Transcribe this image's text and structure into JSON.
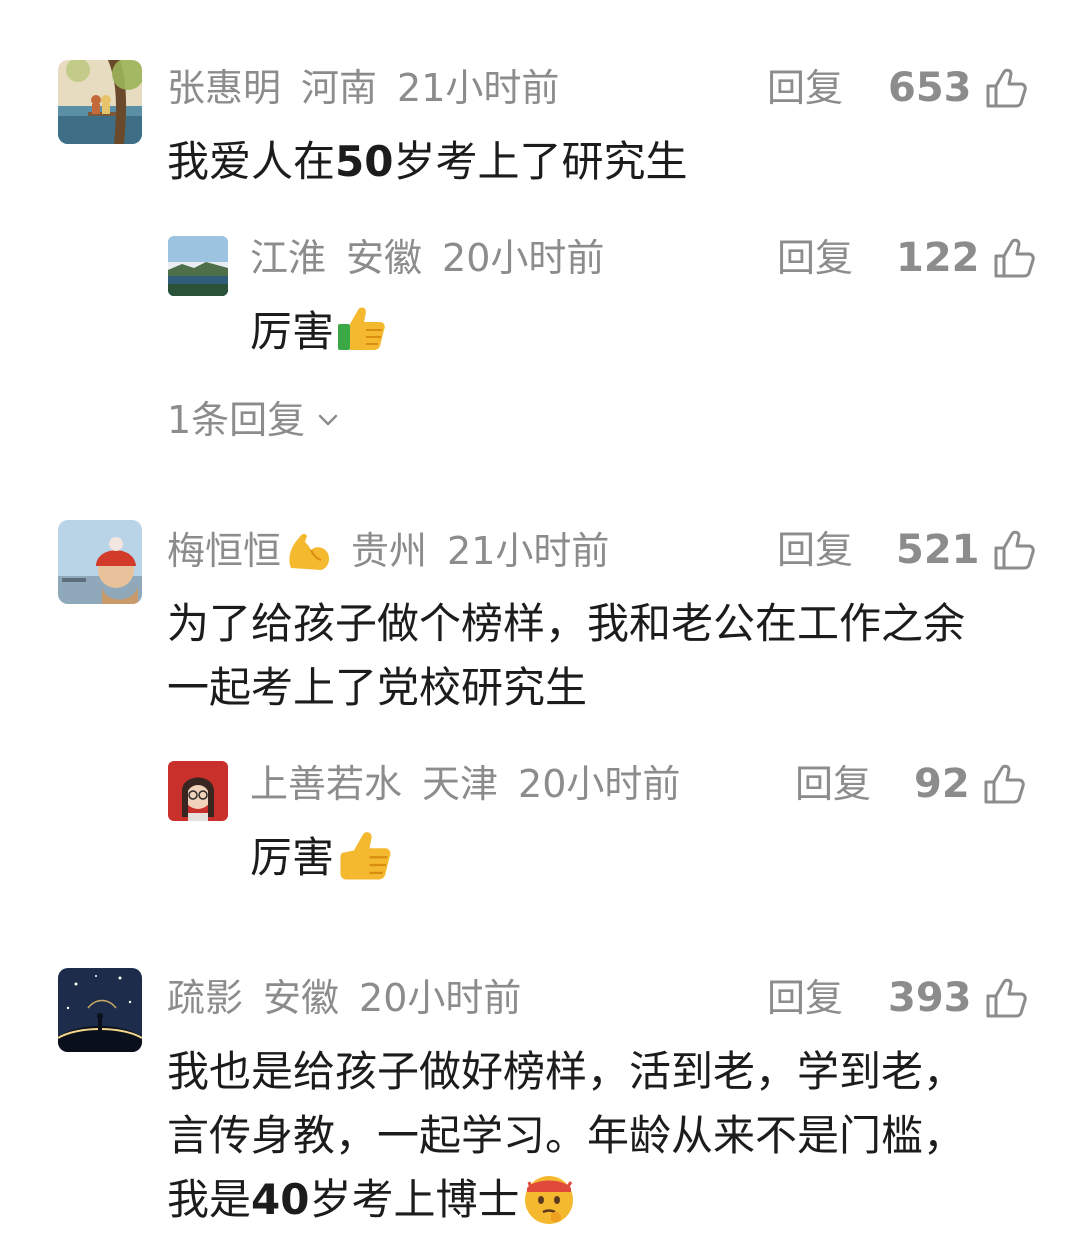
{
  "comments": [
    {
      "user": "张惠明",
      "location": "河南",
      "time": "21小时前",
      "reply_label": "回复",
      "likes": "653",
      "text_a": "我爱人在",
      "text_num": "50",
      "text_b": "岁考上了研究生",
      "replies": [
        {
          "user": "江淮",
          "location": "安徽",
          "time": "20小时前",
          "reply_label": "回复",
          "likes": "122",
          "text": "厉害",
          "emoji": "thumbs-up"
        }
      ],
      "more_replies": "1条回复"
    },
    {
      "user": "梅恒恒",
      "name_emoji": "flexed-biceps",
      "location": "贵州",
      "time": "21小时前",
      "reply_label": "回复",
      "likes": "521",
      "line1": "为了给孩子做个榜样，我和老公在工作之余",
      "line2": "一起考上了党校研究生",
      "replies": [
        {
          "user": "上善若水",
          "location": "天津",
          "time": "20小时前",
          "reply_label": "回复",
          "likes": "92",
          "text": "厉害",
          "emoji": "thumbs-up"
        }
      ]
    },
    {
      "user": "疏影",
      "location": "安徽",
      "time": "20小时前",
      "reply_label": "回复",
      "likes": "393",
      "line1": "我也是给孩子做好榜样，活到老，学到老，",
      "line2": "言传身教，一起学习。年龄从来不是门槛，",
      "line3_a": "我是",
      "line3_num": "40",
      "line3_b": "岁考上博士",
      "line3_emoji": "hushed-face"
    }
  ],
  "icons": {
    "like": "thumbs-up-outline-icon",
    "expand": "chevron-down-icon"
  },
  "colors": {
    "text": "#1c1c1c",
    "meta": "#8c8c8c",
    "background": "#ffffff"
  }
}
